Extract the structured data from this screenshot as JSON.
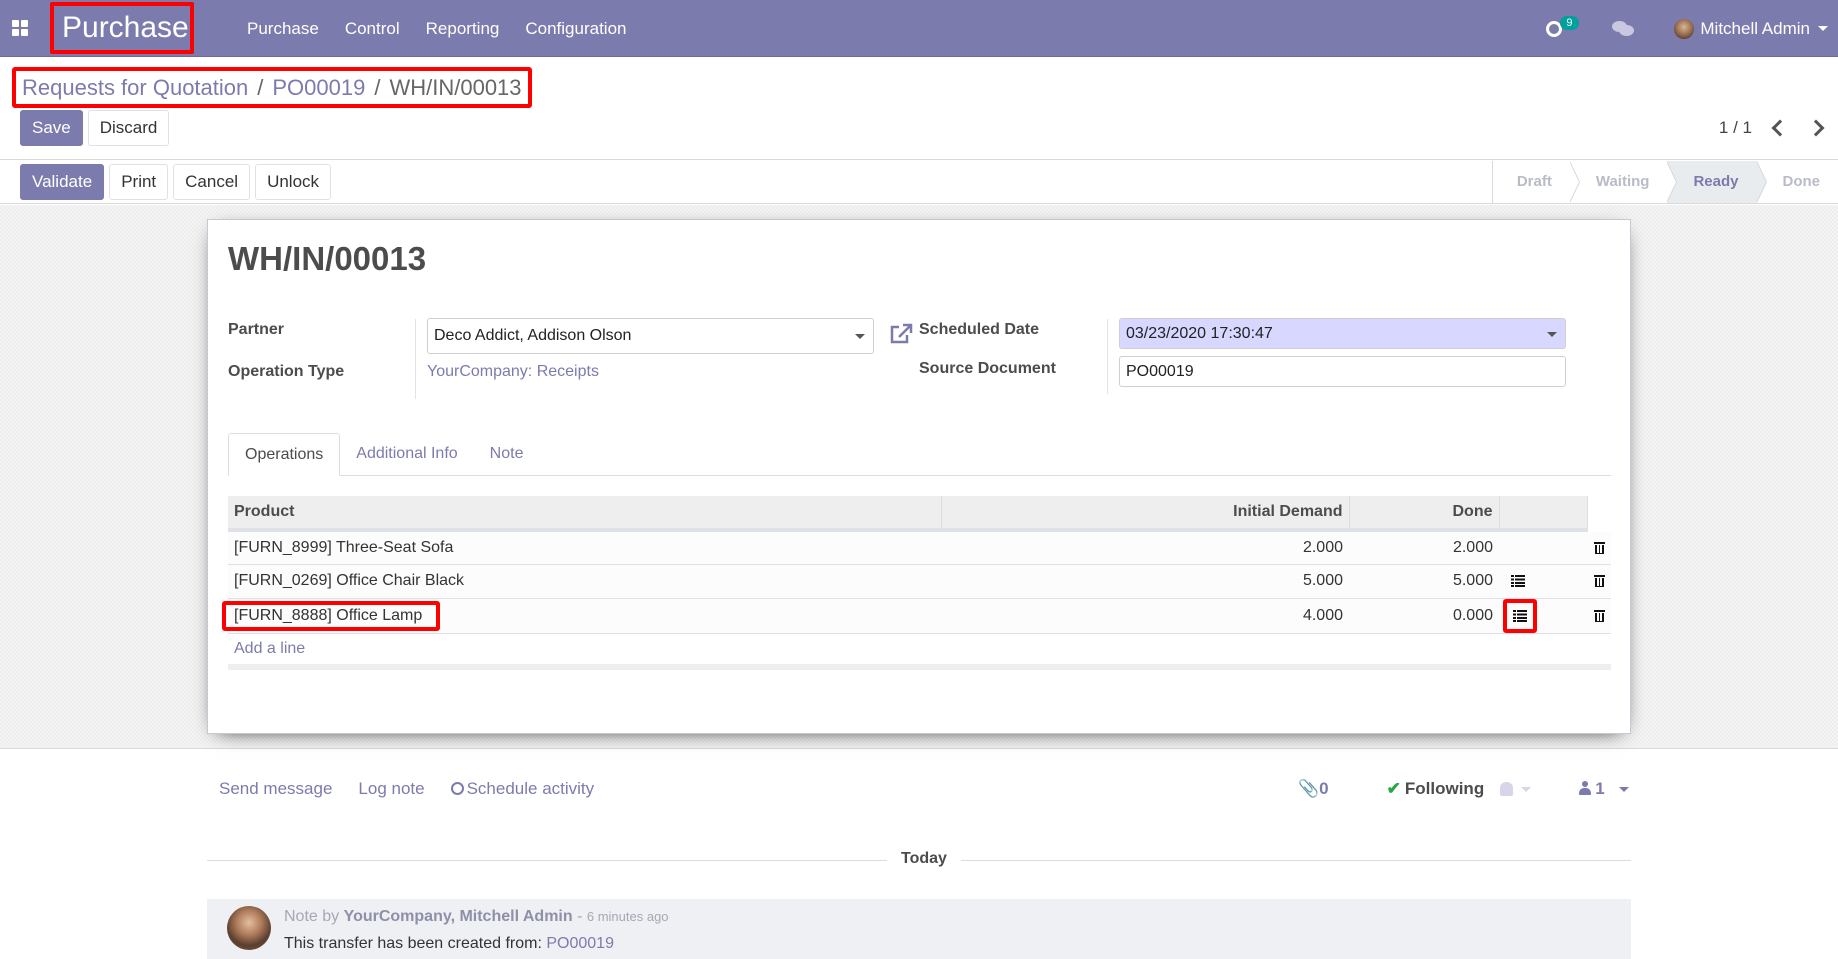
{
  "navbar": {
    "app_name": "Purchase",
    "menu": [
      "Purchase",
      "Control",
      "Reporting",
      "Configuration"
    ],
    "activity_count": "9",
    "user_name": "Mitchell Admin"
  },
  "breadcrumb": {
    "items": [
      "Requests for Quotation",
      "PO00019"
    ],
    "current": "WH/IN/00013",
    "separator": "/"
  },
  "control": {
    "save": "Save",
    "discard": "Discard",
    "pager": "1 / 1"
  },
  "actions": {
    "validate": "Validate",
    "print": "Print",
    "cancel": "Cancel",
    "unlock": "Unlock"
  },
  "stages": {
    "items": [
      "Draft",
      "Waiting",
      "Ready",
      "Done"
    ],
    "current": "Ready"
  },
  "form": {
    "title": "WH/IN/00013",
    "partner_label": "Partner",
    "partner_value": "Deco Addict, Addison Olson",
    "operation_type_label": "Operation Type",
    "operation_type_value": "YourCompany: Receipts",
    "scheduled_date_label": "Scheduled Date",
    "scheduled_date_value": "03/23/2020 17:30:47",
    "source_document_label": "Source Document",
    "source_document_value": "PO00019"
  },
  "tabs": [
    "Operations",
    "Additional Info",
    "Note"
  ],
  "operations": {
    "columns": [
      "Product",
      "Initial Demand",
      "Done"
    ],
    "rows": [
      {
        "product": "[FURN_8999] Three-Seat Sofa",
        "initial_demand": "2.000",
        "done": "2.000",
        "has_details": false
      },
      {
        "product": "[FURN_0269] Office Chair Black",
        "initial_demand": "5.000",
        "done": "5.000",
        "has_details": true
      },
      {
        "product": "[FURN_8888] Office Lamp",
        "initial_demand": "4.000",
        "done": "0.000",
        "has_details": true
      }
    ],
    "add_line": "Add a line"
  },
  "chatter": {
    "send_message": "Send message",
    "log_note": "Log note",
    "schedule_activity": "Schedule activity",
    "attachments": "0",
    "following": "Following",
    "followers": "1",
    "date_separator": "Today",
    "message": {
      "prefix": "Note by",
      "author": "YourCompany, Mitchell Admin",
      "time": "6 minutes ago",
      "body_text": "This transfer has been created from:",
      "body_link": "PO00019"
    }
  },
  "colors": {
    "brand": "#7c7bad",
    "highlight": "#ff0000",
    "success": "#28a745",
    "badge": "#00a09d"
  }
}
